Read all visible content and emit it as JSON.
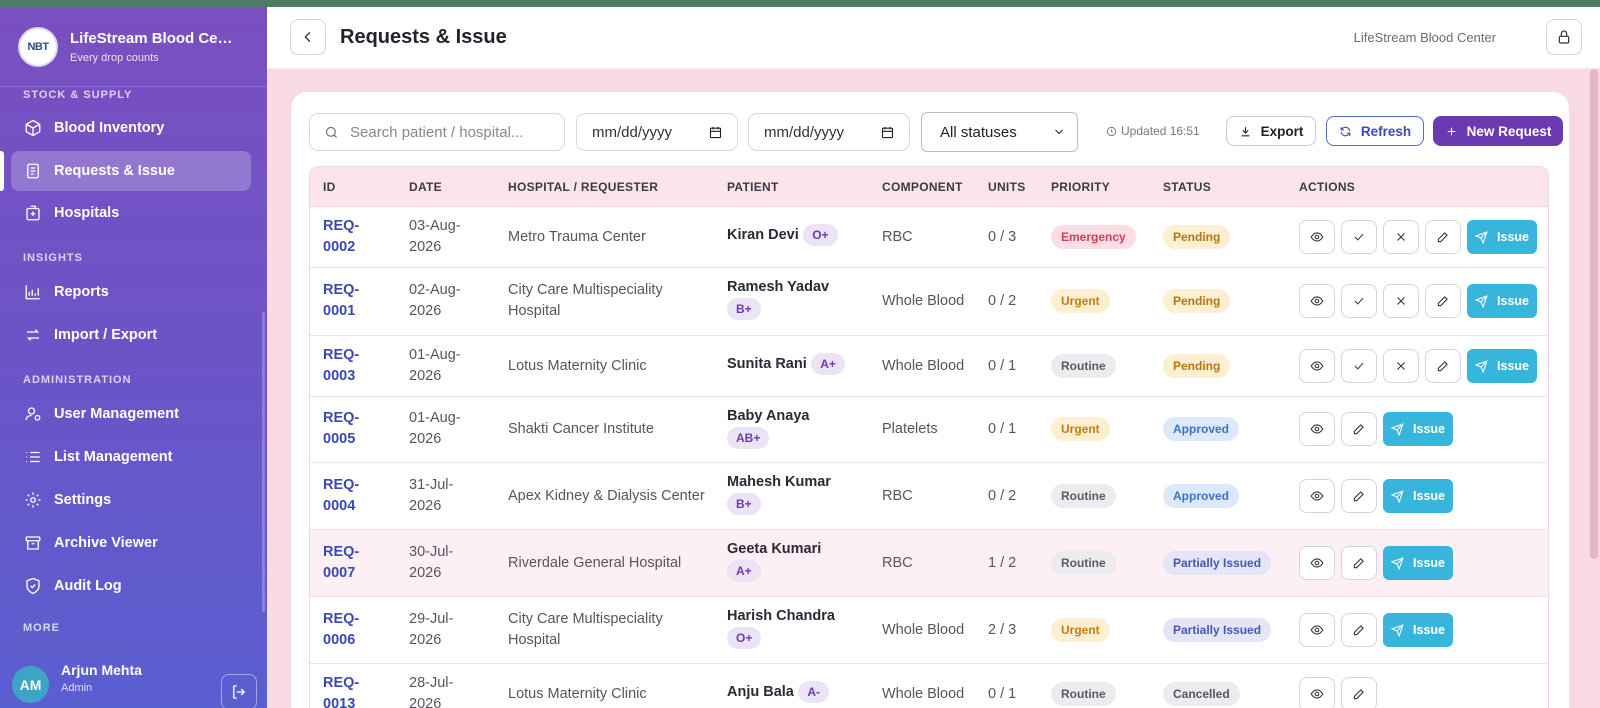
{
  "app": {
    "name": "LifeStream Blood Center",
    "tagline": "Every drop counts",
    "logo_text": "NBT"
  },
  "sidebar": {
    "sections": {
      "stock": "STOCK & SUPPLY",
      "insights": "INSIGHTS",
      "admin": "ADMINISTRATION",
      "more": "MORE"
    },
    "items": [
      {
        "label": "Blood Inventory",
        "icon": "box-icon"
      },
      {
        "label": "Requests & Issue",
        "icon": "clipboard-icon",
        "active": true
      },
      {
        "label": "Hospitals",
        "icon": "hospital-icon"
      },
      {
        "label": "Reports",
        "icon": "chart-icon"
      },
      {
        "label": "Import / Export",
        "icon": "swap-icon"
      },
      {
        "label": "User Management",
        "icon": "user-gear-icon"
      },
      {
        "label": "List Management",
        "icon": "list-icon"
      },
      {
        "label": "Settings",
        "icon": "gear-icon"
      },
      {
        "label": "Archive Viewer",
        "icon": "archive-icon"
      },
      {
        "label": "Audit Log",
        "icon": "shield-icon"
      }
    ],
    "user": {
      "initials": "AM",
      "name": "Arjun Mehta",
      "role": "Admin"
    }
  },
  "header": {
    "title": "Requests & Issue",
    "org": "LifeStream Blood Center"
  },
  "toolbar": {
    "search_placeholder": "Search patient / hospital...",
    "date_from": "mm/dd/yyyy",
    "date_to": "mm/dd/yyyy",
    "status_filter": "All statuses",
    "updated": "Updated 16:51",
    "export_label": "Export",
    "refresh_label": "Refresh",
    "new_label": "New Request"
  },
  "table": {
    "columns": [
      "ID",
      "DATE",
      "HOSPITAL / REQUESTER",
      "PATIENT",
      "COMPONENT",
      "UNITS",
      "PRIORITY",
      "STATUS",
      "ACTIONS"
    ],
    "issue_label": "Issue",
    "rows": [
      {
        "id_a": "REQ-",
        "id_b": "0002",
        "date_a": "03-Aug-",
        "date_b": "2026",
        "hospital": "Metro Trauma Center",
        "patient": "Kiran Devi",
        "blood": "O+",
        "component": "RBC",
        "units": "0 / 3",
        "priority": "Emergency",
        "status": "Pending"
      },
      {
        "id_a": "REQ-",
        "id_b": "0001",
        "date_a": "02-Aug-",
        "date_b": "2026",
        "hospital": "City Care Multispeciality Hospital",
        "patient": "Ramesh Yadav",
        "blood": "B+",
        "component": "Whole Blood",
        "units": "0 / 2",
        "priority": "Urgent",
        "status": "Pending"
      },
      {
        "id_a": "REQ-",
        "id_b": "0003",
        "date_a": "01-Aug-",
        "date_b": "2026",
        "hospital": "Lotus Maternity Clinic",
        "patient": "Sunita Rani",
        "blood": "A+",
        "component": "Whole Blood",
        "units": "0 / 1",
        "priority": "Routine",
        "status": "Pending"
      },
      {
        "id_a": "REQ-",
        "id_b": "0005",
        "date_a": "01-Aug-",
        "date_b": "2026",
        "hospital": "Shakti Cancer Institute",
        "patient": "Baby Anaya",
        "blood": "AB+",
        "component": "Platelets",
        "units": "0 / 1",
        "priority": "Urgent",
        "status": "Approved"
      },
      {
        "id_a": "REQ-",
        "id_b": "0004",
        "date_a": "31-Jul-",
        "date_b": "2026",
        "hospital": "Apex Kidney & Dialysis Center",
        "patient": "Mahesh Kumar",
        "blood": "B+",
        "component": "RBC",
        "units": "0 / 2",
        "priority": "Routine",
        "status": "Approved"
      },
      {
        "id_a": "REQ-",
        "id_b": "0007",
        "date_a": "30-Jul-",
        "date_b": "2026",
        "hospital": "Riverdale General Hospital",
        "patient": "Geeta Kumari",
        "blood": "A+",
        "component": "RBC",
        "units": "1 / 2",
        "priority": "Routine",
        "status": "Partially Issued"
      },
      {
        "id_a": "REQ-",
        "id_b": "0006",
        "date_a": "29-Jul-",
        "date_b": "2026",
        "hospital": "City Care Multispeciality Hospital",
        "patient": "Harish Chandra",
        "blood": "O+",
        "component": "Whole Blood",
        "units": "2 / 3",
        "priority": "Urgent",
        "status": "Partially Issued"
      },
      {
        "id_a": "REQ-",
        "id_b": "0013",
        "date_a": "28-Jul-",
        "date_b": "2026",
        "hospital": "Lotus Maternity Clinic",
        "patient": "Anju Bala",
        "blood": "A-",
        "component": "Whole Blood",
        "units": "0 / 1",
        "priority": "Routine",
        "status": "Cancelled"
      }
    ]
  }
}
